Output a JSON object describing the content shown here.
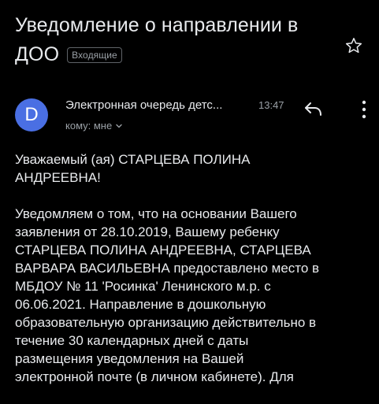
{
  "email": {
    "subject_line1": "Уведомление о направлении в",
    "subject_line2": "ДОО",
    "folder_badge": "Входящие",
    "avatar_letter": "D",
    "avatar_color": "#4a6fe3",
    "sender": "Электронная очередь детс...",
    "time": "13:47",
    "to_label": "кому: мне",
    "greeting_lines": [
      "Уважаемый (ая) СТАРЦЕВА ПОЛИНА",
      "АНДРЕЕВНА!"
    ],
    "body_lines": [
      "Уведомляем о том, что на основании Вашего",
      "заявления от 28.10.2019, Вашему ребенку",
      "СТАРЦЕВА ПОЛИНА АНДРЕЕВНА, СТАРЦЕВА",
      "ВАРВАРА ВАСИЛЬЕВНА предоставлено место в",
      "МБДОУ № 11 'Росинка' Ленинского м.р. с",
      "06.06.2021. Направление в дошкольную",
      "образовательную организацию действительно в",
      "течение 30 календарных дней с даты",
      "размещения уведомления на Вашей",
      "электронной почте (в личном кабинете). Для"
    ]
  },
  "icons": {
    "star": "star-outline-icon",
    "reply": "reply-icon",
    "more": "more-vert-icon",
    "chevron": "chevron-down-icon"
  }
}
